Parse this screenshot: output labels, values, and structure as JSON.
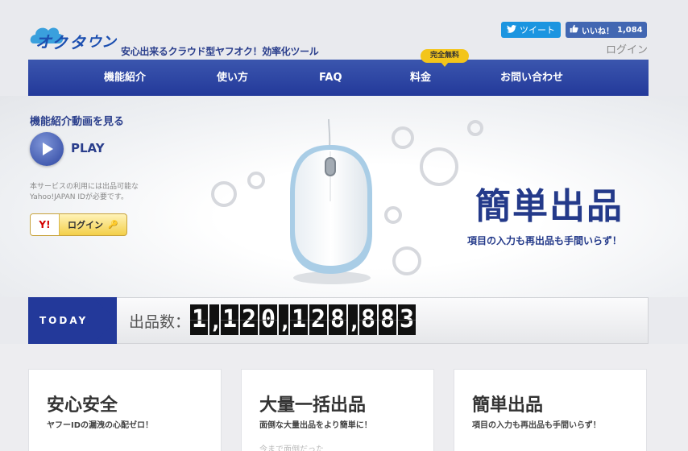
{
  "header": {
    "logo_text": "オークタウン",
    "tagline": "安心出来るクラウド型ヤフオク！効率化ツール",
    "tweet_label": "ツイート",
    "like_label": "いいね！",
    "like_count": "1,084",
    "login_label": "ログイン"
  },
  "nav": {
    "items": [
      {
        "label": "機能紹介"
      },
      {
        "label": "使い方"
      },
      {
        "label": "FAQ"
      },
      {
        "label": "料金"
      },
      {
        "label": "お問い合わせ"
      }
    ],
    "badge": "完全無料"
  },
  "hero": {
    "video_label": "機能紹介動画を見る",
    "play_label": "PLAY",
    "notice": "本サービスの利用には出品可能なYahoo!JAPAN IDが必要です。",
    "yahoo_login": {
      "logo": "Y!",
      "label": "ログイン",
      "icon": "key-icon"
    },
    "title": "簡単出品",
    "subtitle": "項目の入力も再出品も手間いらず！"
  },
  "counter": {
    "today_label": "TODAY",
    "count_label": "出品数：",
    "count_value": "1,120,128,883"
  },
  "cards": [
    {
      "title": "安心安全",
      "subtitle": "ヤフーIDの漏洩の心配ゼロ！",
      "body": ""
    },
    {
      "title": "大量一括出品",
      "subtitle": "面倒な大量出品をより簡単に！",
      "body": "今まで面倒だった"
    },
    {
      "title": "簡単出品",
      "subtitle": "項目の入力も再出品も手間いらず！",
      "body": ""
    }
  ],
  "colors": {
    "brand": "#23399a",
    "badge": "#f3c51b",
    "twitter": "#1b95e0",
    "facebook": "#4267b2"
  }
}
